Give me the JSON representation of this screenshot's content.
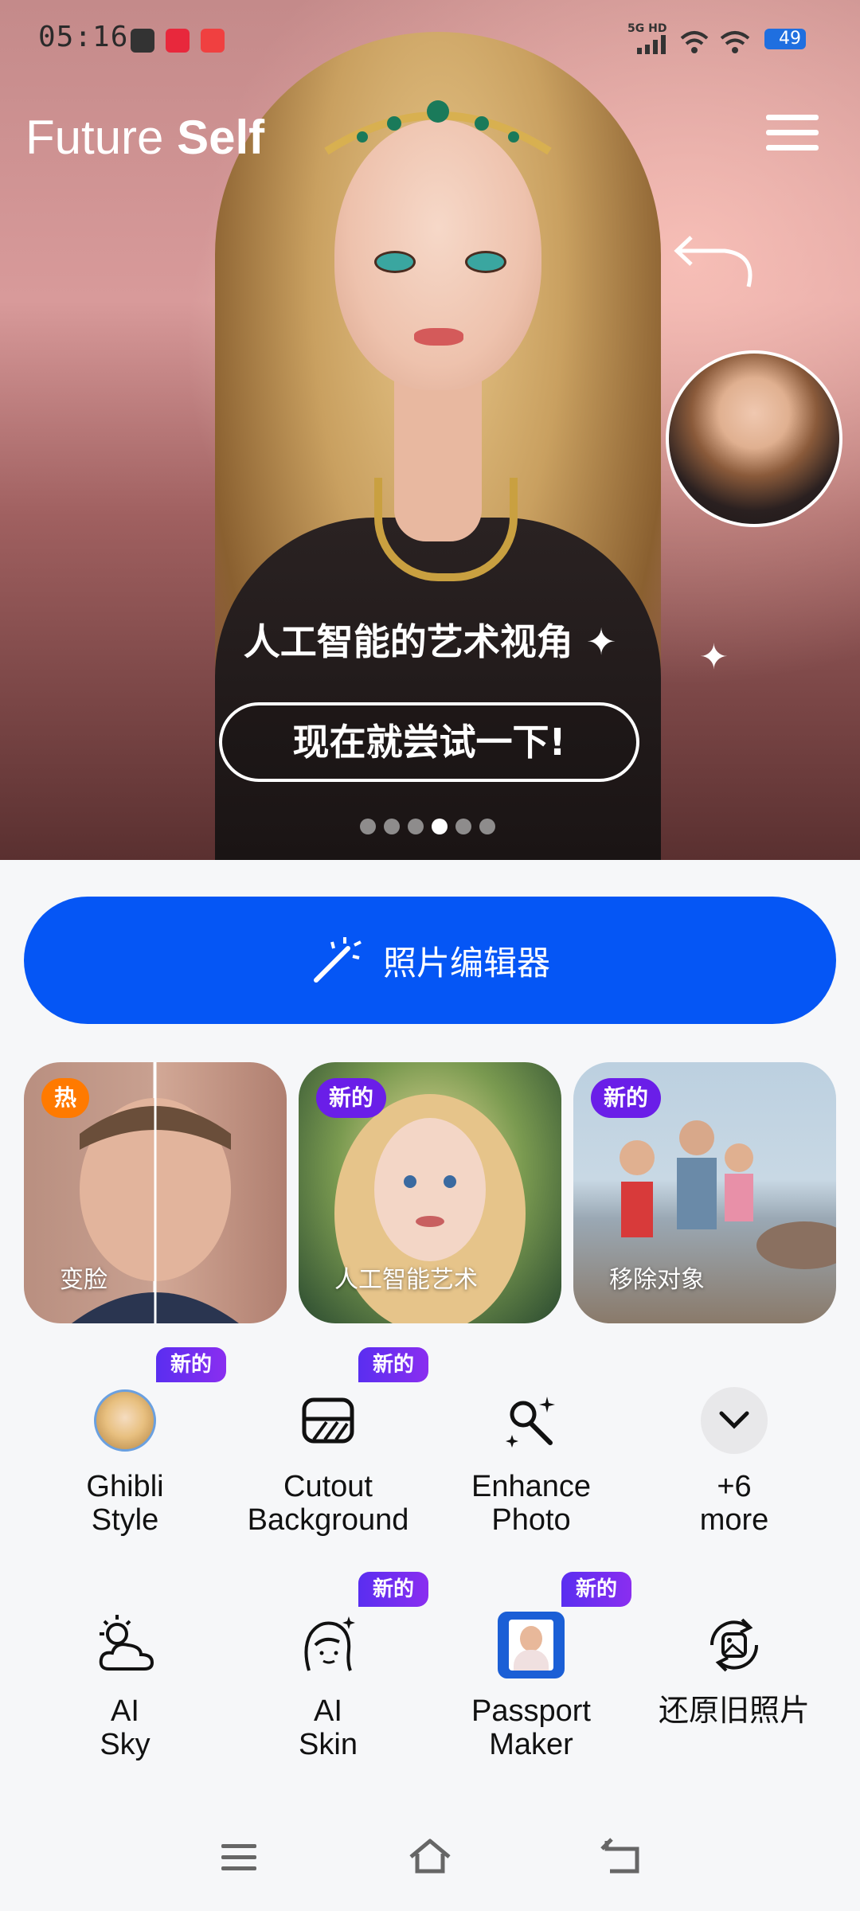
{
  "status_bar": {
    "time": "05:16",
    "network": "5G HD",
    "battery": "49"
  },
  "app": {
    "title_light": "Future ",
    "title_bold": "Self"
  },
  "hero": {
    "caption": "人工智能的艺术视角",
    "try_button": "现在就尝试一下!",
    "carousel_total": 6,
    "carousel_active": 4
  },
  "editor_button": {
    "label": "照片编辑器"
  },
  "cards": [
    {
      "badge": "热",
      "badge_type": "hot",
      "label": "变脸"
    },
    {
      "badge": "新的",
      "badge_type": "new",
      "label": "人工智能艺术"
    },
    {
      "badge": "新的",
      "badge_type": "new",
      "label": "移除对象"
    }
  ],
  "tools_row1": [
    {
      "line1": "Ghibli",
      "line2": "Style",
      "tag": "新的",
      "icon": "ghibli-avatar-icon"
    },
    {
      "line1": "Cutout",
      "line2": "Background",
      "tag": "新的",
      "icon": "cutout-icon"
    },
    {
      "line1": "Enhance",
      "line2": "Photo",
      "tag": "",
      "icon": "enhance-icon"
    },
    {
      "line1": "+6",
      "line2": "more",
      "tag": "",
      "icon": "chevron-down-icon"
    }
  ],
  "tools_row2": [
    {
      "line1": "AI",
      "line2": "Sky",
      "tag": "",
      "icon": "sky-icon"
    },
    {
      "line1": "AI",
      "line2": "Skin",
      "tag": "新的",
      "icon": "skin-icon"
    },
    {
      "line1": "Passport",
      "line2": "Maker",
      "tag": "新的",
      "icon": "passport-icon"
    },
    {
      "line1": "还原旧照片",
      "line2": "",
      "tag": "",
      "icon": "restore-icon"
    }
  ],
  "colors": {
    "primary": "#0556f5",
    "hot": "#ff7a00",
    "new": "#6a1ee8"
  }
}
